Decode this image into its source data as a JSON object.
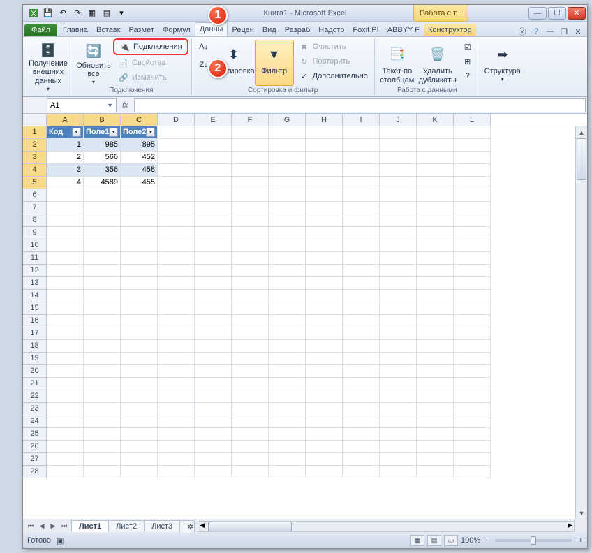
{
  "title": "Книга1  -  Microsoft Excel",
  "table_tools": "Работа с т...",
  "tabs": {
    "file": "Файл",
    "items": [
      "Главна",
      "Вставк",
      "Размет",
      "Формул",
      "Данны",
      "Рецен",
      "Вид",
      "Разраб",
      "Надстр",
      "Foxit PI",
      "ABBYY F",
      "Конструктор"
    ],
    "active_index": 4
  },
  "ribbon": {
    "group1": {
      "label": "",
      "btn1": "Получение внешних данных"
    },
    "group2": {
      "label": "Подключения",
      "refresh": "Обновить все",
      "connections": "Подключения",
      "properties": "Свойства",
      "edit": "Изменить"
    },
    "group3": {
      "label": "Сортировка и фильтр",
      "sort": "Сортировка",
      "filter": "Фильтр",
      "clear": "Очистить",
      "reapply": "Повторить",
      "advanced": "Дополнительно"
    },
    "group4": {
      "label": "Работа с данными",
      "text_to_cols": "Текст по столбцам",
      "remove_dupes": "Удалить дубликаты"
    },
    "group5": {
      "label": "",
      "structure": "Структура"
    }
  },
  "name_box": "A1",
  "fx_label": "fx",
  "columns": [
    "A",
    "B",
    "C",
    "D",
    "E",
    "F",
    "G",
    "H",
    "I",
    "J",
    "K",
    "L"
  ],
  "table": {
    "headers": [
      "Код",
      "Поле1",
      "Поле2"
    ],
    "rows": [
      [
        "1",
        "985",
        "895"
      ],
      [
        "2",
        "566",
        "452"
      ],
      [
        "3",
        "356",
        "458"
      ],
      [
        "4",
        "4589",
        "455"
      ]
    ]
  },
  "sheets": [
    "Лист1",
    "Лист2",
    "Лист3"
  ],
  "status": "Готово",
  "zoom": "100%",
  "markers": {
    "1": "1",
    "2": "2"
  }
}
